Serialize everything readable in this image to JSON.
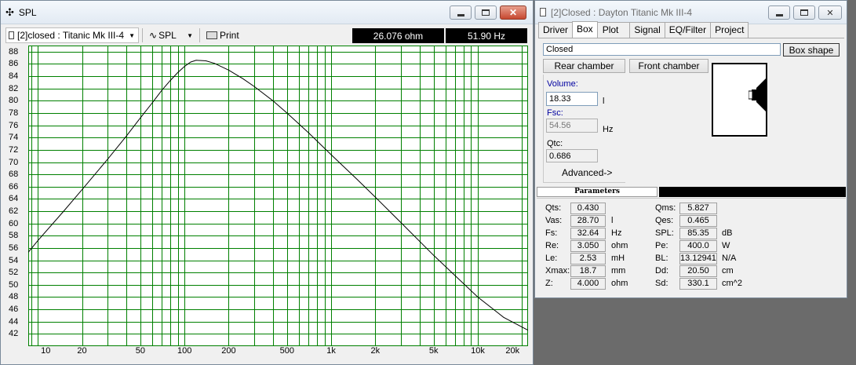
{
  "spl_window": {
    "title": "SPL",
    "driver_select": "[2]closed : Titanic Mk III-4",
    "mode_select": "SPL",
    "print_label": "Print",
    "readout_impedance": "26.076 ohm",
    "readout_frequency": "51.90 Hz",
    "y_tick_labels": [
      "88",
      "86",
      "84",
      "82",
      "80",
      "78",
      "76",
      "74",
      "72",
      "70",
      "68",
      "66",
      "64",
      "62",
      "60",
      "58",
      "56",
      "54",
      "52",
      "50",
      "48",
      "46",
      "44",
      "42"
    ],
    "x_tick_labels": [
      "10",
      "20",
      "50",
      "100",
      "200",
      "500",
      "1k",
      "2k",
      "5k",
      "10k",
      "20k"
    ]
  },
  "chart_data": {
    "type": "line",
    "xscale": "log",
    "xlim": [
      8.6,
      22000
    ],
    "ylim": [
      40,
      89
    ],
    "grid": true,
    "colors": {
      "grid": "#008000",
      "line": "#000000"
    },
    "series": [
      {
        "x": [
          8.6,
          10,
          15,
          20,
          30,
          40,
          50,
          60,
          70,
          80,
          90,
          100,
          110,
          120,
          140,
          160,
          200,
          250,
          300,
          400,
          500,
          700,
          1000,
          1500,
          2000,
          3000,
          5000,
          7000,
          10000,
          15000,
          22000
        ],
        "y": [
          55.3,
          57.2,
          62.0,
          65.5,
          70.5,
          74.2,
          77.2,
          79.6,
          81.7,
          83.3,
          84.6,
          85.6,
          86.3,
          86.6,
          86.5,
          86.1,
          85.0,
          83.6,
          82.3,
          80.0,
          78.0,
          74.8,
          71.2,
          67.2,
          64.3,
          60.1,
          54.8,
          51.5,
          48.0,
          44.7,
          42.6
        ]
      }
    ]
  },
  "box_window": {
    "title": "[2]Closed : Dayton Titanic Mk III-4",
    "tabs": [
      "Driver",
      "Box",
      "Plot",
      "Signal",
      "EQ/Filter",
      "Project"
    ],
    "active_tab": "Box",
    "box_type": "Closed",
    "box_shape_label": "Box shape",
    "rear_chamber_label": "Rear chamber",
    "front_chamber_label": "Front chamber",
    "volume_label": "Volume:",
    "volume_value": "18.33",
    "volume_unit": "l",
    "fsc_label": "Fsc:",
    "fsc_value": "54.56",
    "fsc_unit": "Hz",
    "qtc_label": "Qtc:",
    "qtc_value": "0.686",
    "advanced_label": "Advanced->",
    "params_header": "Parameters",
    "params_left": [
      {
        "label": "Qts:",
        "value": "0.430",
        "unit": ""
      },
      {
        "label": "Vas:",
        "value": "28.70",
        "unit": "l"
      },
      {
        "label": "Fs:",
        "value": "32.64",
        "unit": "Hz"
      },
      {
        "label": "Re:",
        "value": "3.050",
        "unit": "ohm"
      },
      {
        "label": "Le:",
        "value": "2.53",
        "unit": "mH"
      },
      {
        "label": "Xmax:",
        "value": "18.7",
        "unit": "mm"
      },
      {
        "label": "Z:",
        "value": "4.000",
        "unit": "ohm"
      }
    ],
    "params_right": [
      {
        "label": "Qms:",
        "value": "5.827",
        "unit": ""
      },
      {
        "label": "Qes:",
        "value": "0.465",
        "unit": ""
      },
      {
        "label": "SPL:",
        "value": "85.35",
        "unit": "dB"
      },
      {
        "label": "Pe:",
        "value": "400.0",
        "unit": "W"
      },
      {
        "label": "BL:",
        "value": "13.12941",
        "unit": "N/A"
      },
      {
        "label": "Dd:",
        "value": "20.50",
        "unit": "cm"
      },
      {
        "label": "Sd:",
        "value": "330.1",
        "unit": "cm^2"
      }
    ]
  }
}
